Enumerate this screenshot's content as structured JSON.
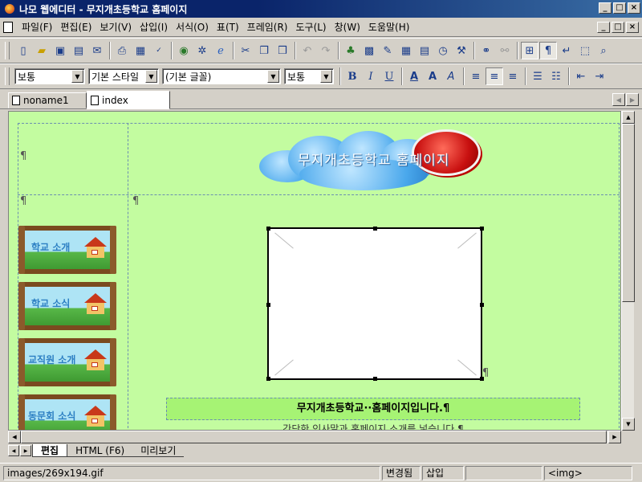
{
  "window": {
    "title": "나모 웹에디터 - 무지개초등학교 홈페이지",
    "min_label": "_",
    "max_label": "□",
    "close_label": "×"
  },
  "menu": {
    "items": [
      {
        "label": "파일(F)"
      },
      {
        "label": "편집(E)"
      },
      {
        "label": "보기(V)"
      },
      {
        "label": "삽입(I)"
      },
      {
        "label": "서식(O)"
      },
      {
        "label": "표(T)"
      },
      {
        "label": "프레임(R)"
      },
      {
        "label": "도구(L)"
      },
      {
        "label": "창(W)"
      },
      {
        "label": "도움말(H)"
      }
    ]
  },
  "format_bar": {
    "paragraph_style": "보통",
    "char_style": "기본 스타일",
    "font": "(기본 글꼴)",
    "size": "보통"
  },
  "doc_tabs": [
    {
      "label": "noname1",
      "active": false
    },
    {
      "label": "index",
      "active": true
    }
  ],
  "page": {
    "pilcrow": "¶",
    "banner_text": "무지개초등학교 홈페이지",
    "nav_images": [
      {
        "label": "학교 소개"
      },
      {
        "label": "학교 소식"
      },
      {
        "label": "교직원 소개"
      },
      {
        "label": "동문회 소식"
      }
    ],
    "caption_line1": "무지개초등학교··홈페이지입니다.¶",
    "caption_line2": "간단한 인사말과 홈페이지 소개를 넣습니다.¶"
  },
  "view_tabs": [
    {
      "label": "편집",
      "active": true
    },
    {
      "label": "HTML (F6)",
      "active": false
    },
    {
      "label": "미리보기",
      "active": false
    }
  ],
  "status": {
    "path": "images/269x194.gif",
    "modified": "변경됨",
    "insert_mode": "삽입",
    "tag": "<img>"
  }
}
